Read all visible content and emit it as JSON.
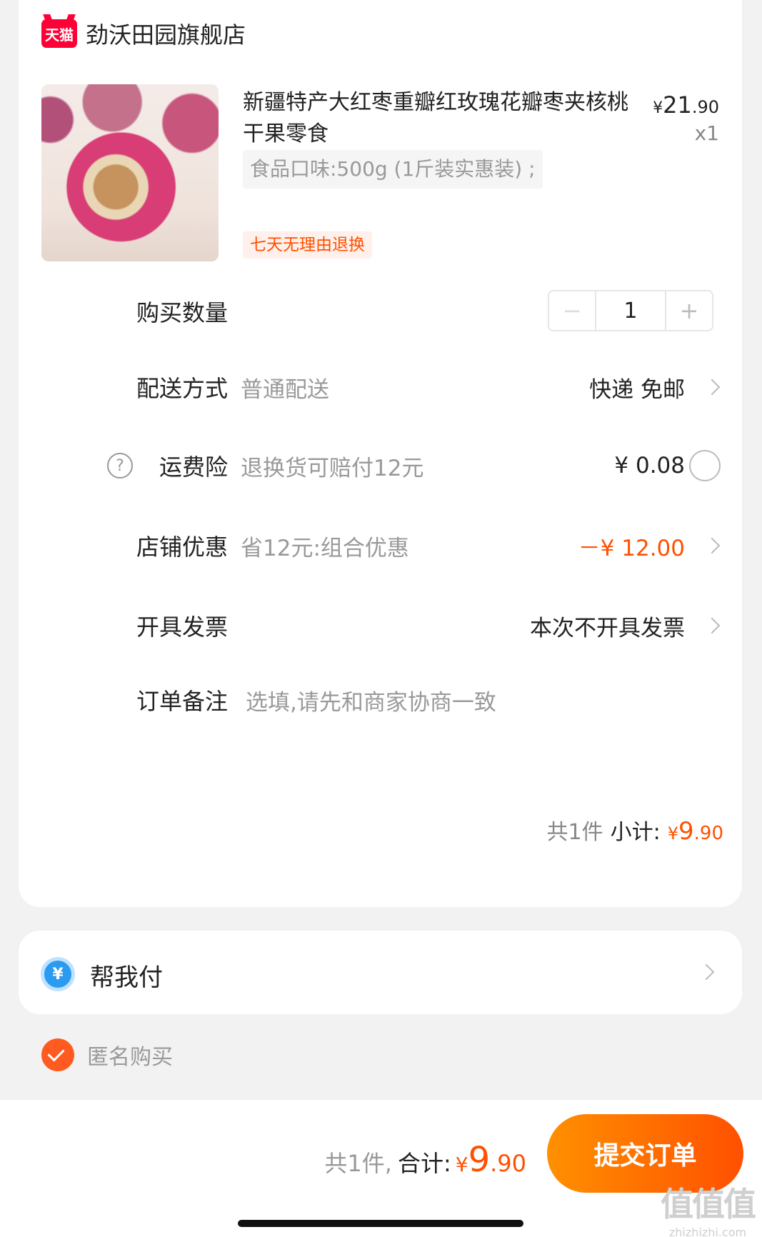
{
  "store": {
    "badge": "天猫",
    "name": "劲沃田园旗舰店"
  },
  "product": {
    "title": "新疆特产大红枣重瓣红玫瑰花瓣枣夹核桃干果零食",
    "price_yen": "¥",
    "price_int": "21",
    "price_cents": ".90",
    "quantity": "x1",
    "sku": "食品口味:500g (1斤装实惠装) ;",
    "return_badge": "七天无理由退换"
  },
  "rows": {
    "qty_label": "购买数量",
    "qty_minus": "−",
    "qty_value": "1",
    "qty_plus": "+",
    "delivery_label": "配送方式",
    "delivery_sub": "普通配送",
    "delivery_value": "快递 免邮",
    "insurance_label": "运费险",
    "insurance_sub": "退换货可赔付12元",
    "insurance_value": "¥ 0.08",
    "discount_label": "店铺优惠",
    "discount_sub": "省12元:组合优惠",
    "discount_value": "－¥ 12.00",
    "invoice_label": "开具发票",
    "invoice_value": "本次不开具发票",
    "note_label": "订单备注",
    "note_placeholder": "选填,请先和商家协商一致"
  },
  "subtotal": {
    "count": "共1件",
    "label": "小计:",
    "yen": "¥",
    "int": "9",
    "cents": ".90"
  },
  "pay_for_me": {
    "icon_glyph": "¥",
    "label": "帮我付"
  },
  "anonymous": {
    "label": "匿名购买",
    "checked": true
  },
  "footer": {
    "count": "共1件,",
    "label": "合计:",
    "yen": "¥",
    "int": "9",
    "cents": ".90",
    "submit": "提交订单"
  },
  "watermark": {
    "big": "值值值",
    "small": "zhizhizhi.com"
  },
  "colors": {
    "accent": "#ff5000",
    "tmall_red": "#ff0036",
    "background": "#f2f2f2"
  }
}
